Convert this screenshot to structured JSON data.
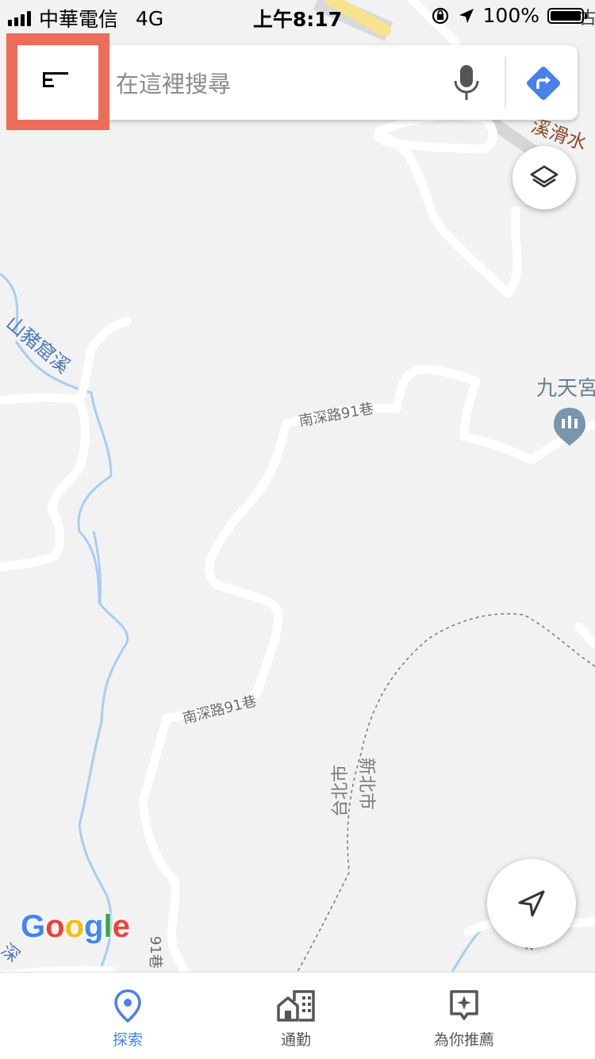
{
  "status_bar": {
    "carrier": "中華電信",
    "network": "4G",
    "time": "上午8:17",
    "battery_text": "100%",
    "battery_level": 1.0
  },
  "search": {
    "placeholder": "在這裡搜尋"
  },
  "map": {
    "labels": {
      "road_top": "南深路91巷",
      "road_middle": "南深路91巷",
      "road_bottom": "91巷",
      "creek_left": "山豬窟溪",
      "creek_bottom_right": "深",
      "creek_bottom_left": "深",
      "city_left": "台北市",
      "city_right": "新北市",
      "place": "九天宮",
      "road_top_right": "溪滑水",
      "corner_top_right": "古"
    },
    "colors": {
      "background": "#f2f2f2",
      "road": "#ffffff",
      "water": "#a8cdf5",
      "label": "#6b6b6b",
      "water_label": "#4d78b8",
      "highway": "#f7e38d",
      "brown_label": "#8b4a2b"
    }
  },
  "logo": {
    "letters": [
      {
        "char": "G",
        "color": "#4285f4"
      },
      {
        "char": "o",
        "color": "#ea4335"
      },
      {
        "char": "o",
        "color": "#fbbc05"
      },
      {
        "char": "g",
        "color": "#4285f4"
      },
      {
        "char": "l",
        "color": "#34a853"
      },
      {
        "char": "e",
        "color": "#ea4335"
      }
    ]
  },
  "bottom_nav": {
    "items": [
      {
        "label": "探索",
        "active": true
      },
      {
        "label": "通勤",
        "active": false
      },
      {
        "label": "為你推薦",
        "active": false
      }
    ]
  },
  "colors": {
    "accent": "#4a80e8",
    "highlight": "#ee6c5a",
    "directions": "#4a80e8"
  },
  "icons": {
    "menu": "menu-icon",
    "mic": "microphone-icon",
    "directions": "directions-icon",
    "layers": "layers-icon",
    "locate": "navigation-arrow-icon"
  }
}
